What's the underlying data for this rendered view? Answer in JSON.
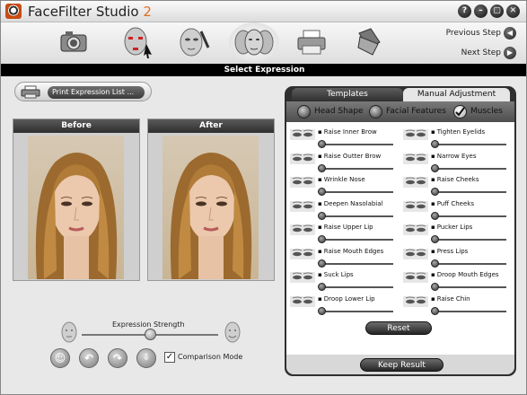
{
  "app": {
    "title": "FaceFilter Studio",
    "version": "2"
  },
  "toolbar": {
    "tools": [
      {
        "name": "camera-icon"
      },
      {
        "name": "face-markers-icon"
      },
      {
        "name": "face-brush-icon"
      },
      {
        "name": "expression-faces-icon"
      },
      {
        "name": "printer-icon"
      },
      {
        "name": "folder-icon"
      }
    ],
    "previous_step": "Previous Step",
    "next_step": "Next Step"
  },
  "section_title": "Select Expression",
  "print_button": "Print Expression List ...",
  "photos": {
    "before_label": "Before",
    "after_label": "After"
  },
  "strength": {
    "label": "Expression Strength",
    "value": 0.5
  },
  "comparison": {
    "label": "Comparison Mode",
    "checked": true
  },
  "tabs": {
    "templates": "Templates",
    "manual": "Manual Adjustment",
    "active": "manual"
  },
  "subnav": {
    "items": [
      {
        "label": "Head Shape"
      },
      {
        "label": "Facial Features"
      },
      {
        "label": "Muscles"
      }
    ],
    "selected": "Muscles"
  },
  "muscles": {
    "left": [
      {
        "label": "Raise Inner Brow",
        "value": 0
      },
      {
        "label": "Raise Outter Brow",
        "value": 0
      },
      {
        "label": "Wrinkle Nose",
        "value": 0
      },
      {
        "label": "Deepen Nasolabial",
        "value": 0
      },
      {
        "label": "Raise Upper Lip",
        "value": 0
      },
      {
        "label": "Raise Mouth Edges",
        "value": 0
      },
      {
        "label": "Suck Lips",
        "value": 0
      },
      {
        "label": "Droop Lower Lip",
        "value": 0
      }
    ],
    "right": [
      {
        "label": "Tighten Eyelids",
        "value": 0
      },
      {
        "label": "Narrow Eyes",
        "value": 0
      },
      {
        "label": "Raise Cheeks",
        "value": 0
      },
      {
        "label": "Puff Cheeks",
        "value": 0
      },
      {
        "label": "Pucker Lips",
        "value": 0
      },
      {
        "label": "Press Lips",
        "value": 0
      },
      {
        "label": "Droop Mouth Edges",
        "value": 0
      },
      {
        "label": "Raise Chin",
        "value": 0
      }
    ]
  },
  "reset_label": "Reset",
  "keep_label": "Keep Result",
  "window_buttons": [
    "?",
    "–",
    "▢",
    "✕"
  ]
}
